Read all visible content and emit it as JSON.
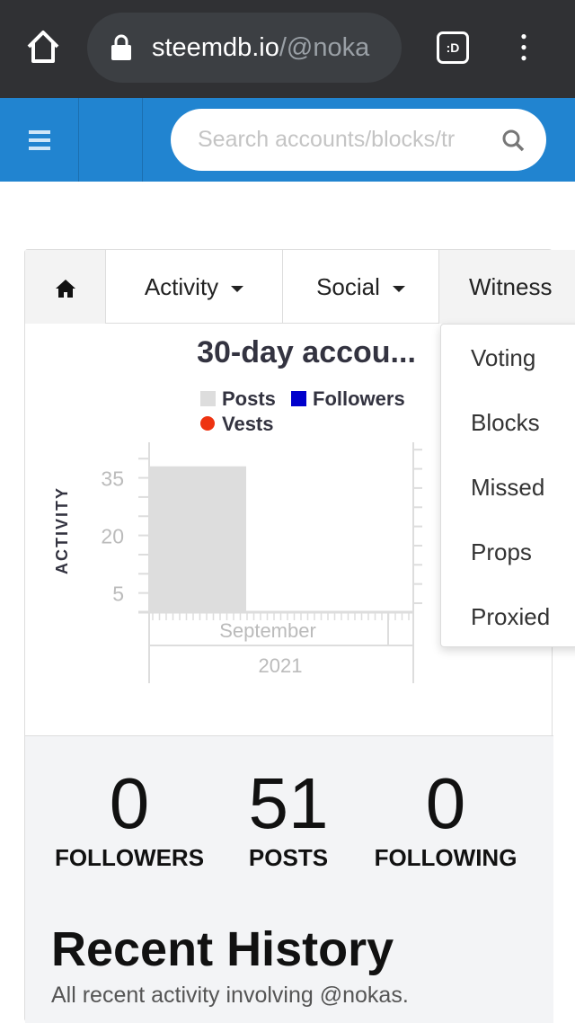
{
  "browser": {
    "url_host": "steemdb.io",
    "url_path": "/@noka"
  },
  "nav": {
    "search_placeholder": "Search accounts/blocks/tr"
  },
  "tabs": [
    {
      "label": "Activity"
    },
    {
      "label": "Social"
    },
    {
      "label": "Witness"
    }
  ],
  "witness_menu": [
    "Voting",
    "Blocks",
    "Missed",
    "Props",
    "Proxied"
  ],
  "chart_data": {
    "type": "bar",
    "title": "30-day accou...",
    "legend": [
      {
        "name": "Posts",
        "color": "#dddddd",
        "shape": "square"
      },
      {
        "name": "Followers",
        "color": "#0000cc",
        "shape": "square"
      },
      {
        "name": "Vests",
        "color": "#ee3311",
        "shape": "circle"
      }
    ],
    "ylabel": "ACTIVITY",
    "yticks": [
      35,
      20,
      5
    ],
    "ylim": [
      0,
      38
    ],
    "xlabel_month": "September",
    "xlabel_year": "2021",
    "series": [
      {
        "name": "Posts",
        "values": [
          38
        ]
      }
    ]
  },
  "stats": [
    {
      "value": "0",
      "label": "FOLLOWERS"
    },
    {
      "value": "51",
      "label": "POSTS"
    },
    {
      "value": "0",
      "label": "FOLLOWING"
    }
  ],
  "history": {
    "title": "Recent History",
    "subtitle": "All recent activity involving @nokas."
  }
}
